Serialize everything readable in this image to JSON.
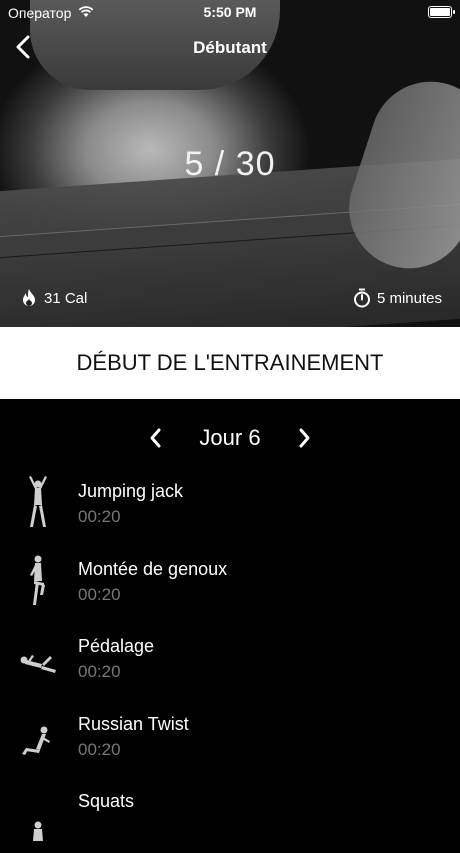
{
  "status": {
    "carrier": "Оператор",
    "time": "5:50 PM"
  },
  "header": {
    "title": "Débutant"
  },
  "hero": {
    "progress": "5 / 30",
    "calories": "31 Cal",
    "duration": "5 minutes"
  },
  "start_button": {
    "label": "DÉBUT DE L'ENTRAINEMENT"
  },
  "day_nav": {
    "label": "Jour 6"
  },
  "exercises": [
    {
      "name": "Jumping jack",
      "time": "00:20",
      "icon": "jumping-jack-figure"
    },
    {
      "name": "Montée de genoux",
      "time": "00:20",
      "icon": "high-knees-figure"
    },
    {
      "name": "Pédalage",
      "time": "00:20",
      "icon": "bicycle-crunch-figure"
    },
    {
      "name": "Russian Twist",
      "time": "00:20",
      "icon": "russian-twist-figure"
    },
    {
      "name": "Squats",
      "time": "",
      "icon": "squat-figure"
    }
  ],
  "colors": {
    "background": "#000000",
    "start_button_bg": "#ffffff",
    "secondary_text": "#777777"
  }
}
